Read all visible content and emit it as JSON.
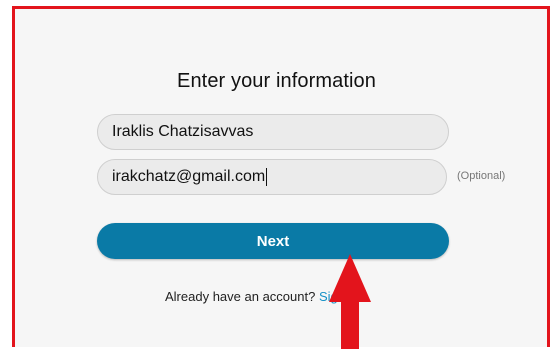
{
  "form": {
    "title": "Enter your information",
    "name_value": "Iraklis Chatzisavvas",
    "email_value": "irakchatz@gmail.com",
    "email_optional_label": "(Optional)",
    "next_label": "Next",
    "signin_prompt": "Already have an account?",
    "signin_link": "Sign in"
  },
  "colors": {
    "frame_border": "#e3141c",
    "button": "#0a7aa6",
    "link": "#1591c7",
    "arrow": "#e3141c"
  },
  "icons": [
    "caret-text-cursor",
    "annotation-arrow"
  ]
}
